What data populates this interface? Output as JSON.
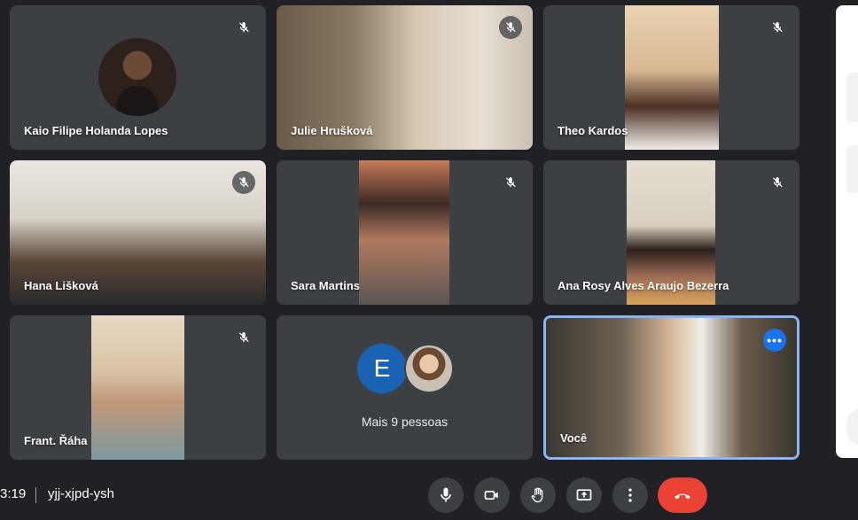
{
  "meeting": {
    "clock": "3:19",
    "code": "yjj-xjpd-ysh"
  },
  "participants": [
    {
      "name": "Kaio Filipe Holanda Lopes",
      "muted": true
    },
    {
      "name": "Julie Hrušková",
      "muted": true
    },
    {
      "name": "Theo Kardos",
      "muted": true
    },
    {
      "name": "Hana Lišková",
      "muted": true
    },
    {
      "name": "Sara Martins",
      "muted": true
    },
    {
      "name": "Ana Rosy Alves Araujo Bezerra",
      "muted": true
    },
    {
      "name": "Frant. Řáha",
      "muted": true
    }
  ],
  "more": {
    "avatar_letter": "E",
    "label": "Mais 9 pessoas"
  },
  "self": {
    "name": "Você"
  },
  "icons": {
    "mute": "mic-off-icon",
    "more": "more-options-icon"
  },
  "colors": {
    "background": "#202124",
    "tile": "#3c4043",
    "accent": "#1a73e8",
    "hangup": "#ea4335",
    "self_border": "#8ab4f8"
  }
}
